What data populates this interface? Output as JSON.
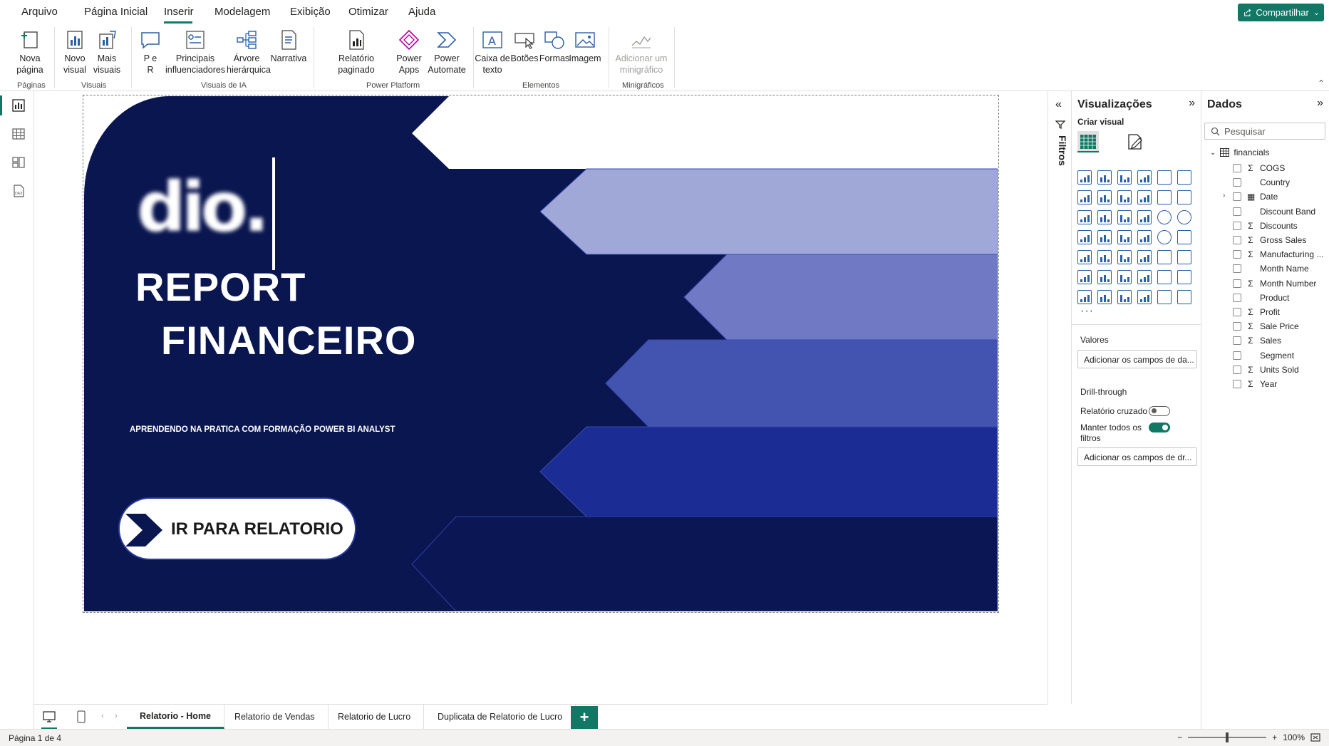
{
  "menu": {
    "items": [
      "Arquivo",
      "Página Inicial",
      "Inserir",
      "Modelagem",
      "Exibição",
      "Otimizar",
      "Ajuda"
    ],
    "active": "Inserir",
    "share_label": "Compartilhar"
  },
  "ribbon": {
    "nova_pagina": "Nova página",
    "novo_visual": "Novo visual",
    "mais_visuais": "Mais visuais",
    "p_e_r": "P e R",
    "principais_influenciadores": "Principais influenciadores",
    "arvore": "Árvore hierárquica",
    "narrativa": "Narrativa",
    "relatorio_paginado": "Relatório paginado",
    "power_apps": "Power Apps",
    "power_automate": "Power Automate",
    "caixa_texto": "Caixa de texto",
    "botoes": "Botões",
    "formas": "Formas",
    "imagem": "Imagem",
    "minigrafico": "Adicionar um minigráfico",
    "groups": {
      "paginas": "Páginas",
      "visuais": "Visuais",
      "visuais_ia": "Visuais de IA",
      "power_platform": "Power Platform",
      "elementos": "Elementos",
      "minigraficos": "Minigráficos"
    }
  },
  "report": {
    "logo_text": "dio.",
    "title_line1": "REPORT",
    "title_line2": "FINANCEIRO",
    "subtitle": "APRENDENDO NA PRATICA COM FORMAÇÃO POWER BI ANALYST",
    "button_label": "IR PARA RELATORIO",
    "colors": {
      "background": "#0a1650",
      "band1": "#ffffff",
      "band2": "#a0a8d8",
      "band3": "#6f79c4",
      "band4": "#4353b0",
      "band5": "#1b2d94",
      "band6": "#0b1755"
    }
  },
  "filters": {
    "label": "Filtros"
  },
  "viz": {
    "title": "Visualizações",
    "criar_visual": "Criar visual",
    "valores": "Valores",
    "valores_placeholder": "Adicionar os campos de da...",
    "drillthrough": "Drill-through",
    "relatorio_cruzado": "Relatório cruzado",
    "relatorio_cruzado_on": false,
    "manter_filtros": "Manter todos os filtros",
    "manter_filtros_on": true,
    "drill_placeholder": "Adicionar os campos de dr..."
  },
  "data_pane": {
    "title": "Dados",
    "search_placeholder": "Pesquisar",
    "table": "financials",
    "fields": [
      {
        "name": "COGS",
        "sum": true
      },
      {
        "name": "Country",
        "sum": false
      },
      {
        "name": "Date",
        "sum": false,
        "date": true
      },
      {
        "name": "Discount Band",
        "sum": false
      },
      {
        "name": "Discounts",
        "sum": true
      },
      {
        "name": "Gross Sales",
        "sum": true
      },
      {
        "name": "Manufacturing ...",
        "sum": true
      },
      {
        "name": "Month Name",
        "sum": false
      },
      {
        "name": "Month Number",
        "sum": true
      },
      {
        "name": "Product",
        "sum": false
      },
      {
        "name": "Profit",
        "sum": true
      },
      {
        "name": "Sale Price",
        "sum": true
      },
      {
        "name": "Sales",
        "sum": true
      },
      {
        "name": "Segment",
        "sum": false
      },
      {
        "name": "Units Sold",
        "sum": true
      },
      {
        "name": "Year",
        "sum": true
      }
    ]
  },
  "tabs": {
    "items": [
      "Relatorio - Home",
      "Relatorio de Vendas",
      "Relatorio de Lucro",
      "Duplicata de Relatorio de Lucro"
    ],
    "active": "Relatorio - Home",
    "add": "+"
  },
  "status": {
    "page": "Página 1 de 4",
    "zoom": "100%",
    "zoom_fraction": 0.5
  },
  "colors": {
    "accent": "#117865",
    "icon_blue": "#2b5fa6"
  }
}
